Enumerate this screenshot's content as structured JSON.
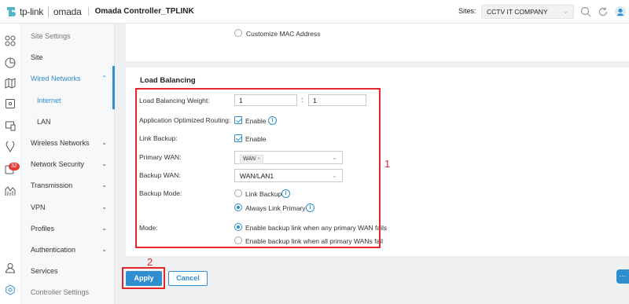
{
  "header": {
    "brand": "tp-link",
    "product": "omada",
    "controller_title": "Omada Controller_TPLINK",
    "sites_label": "Sites:",
    "site_selected": "CCTV IT COMPANY"
  },
  "icons": {
    "rail": [
      "dashboard-icon",
      "statistics-icon",
      "map-icon",
      "devices-icon",
      "clients-icon",
      "insight-icon",
      "logs-icon",
      "reports-icon",
      "account-icon",
      "settings-icon"
    ],
    "top": [
      "search-icon",
      "refresh-icon",
      "user-icon"
    ]
  },
  "rail": {
    "badge": "32"
  },
  "sidebar": {
    "items": [
      {
        "label": "Site Settings"
      },
      {
        "label": "Site"
      },
      {
        "label": "Wired Networks"
      },
      {
        "label": "Internet"
      },
      {
        "label": "LAN"
      },
      {
        "label": "Wireless Networks"
      },
      {
        "label": "Network Security"
      },
      {
        "label": "Transmission"
      },
      {
        "label": "VPN"
      },
      {
        "label": "Profiles"
      },
      {
        "label": "Authentication"
      },
      {
        "label": "Services"
      },
      {
        "label": "Controller Settings"
      }
    ]
  },
  "form": {
    "customize_mac": "Customize MAC Address",
    "section_title": "Load Balancing",
    "weight_label": "Load Balancing Weight:",
    "weight_a": "1",
    "weight_b": "1",
    "colon": ":",
    "app_routing_label": "Application Optimized Routing:",
    "app_routing_value": "Enable",
    "link_backup_label": "Link Backup:",
    "link_backup_value": "Enable",
    "primary_wan_label": "Primary WAN:",
    "primary_wan_tag": "WAN",
    "backup_wan_label": "Backup WAN:",
    "backup_wan_value": "WAN/LAN1",
    "backup_mode_label": "Backup Mode:",
    "backup_mode_opt1": "Link Backup",
    "backup_mode_opt2": "Always Link Primary",
    "mode_label": "Mode:",
    "mode_opt1": "Enable backup link when any primary WAN fails",
    "mode_opt2": "Enable backup link when all primary WANs fail"
  },
  "annotations": {
    "box1": "1",
    "box2": "2"
  },
  "actions": {
    "apply": "Apply",
    "cancel": "Cancel"
  },
  "colors": {
    "accent": "#2f8ecf",
    "annotation": "#e3262a"
  }
}
